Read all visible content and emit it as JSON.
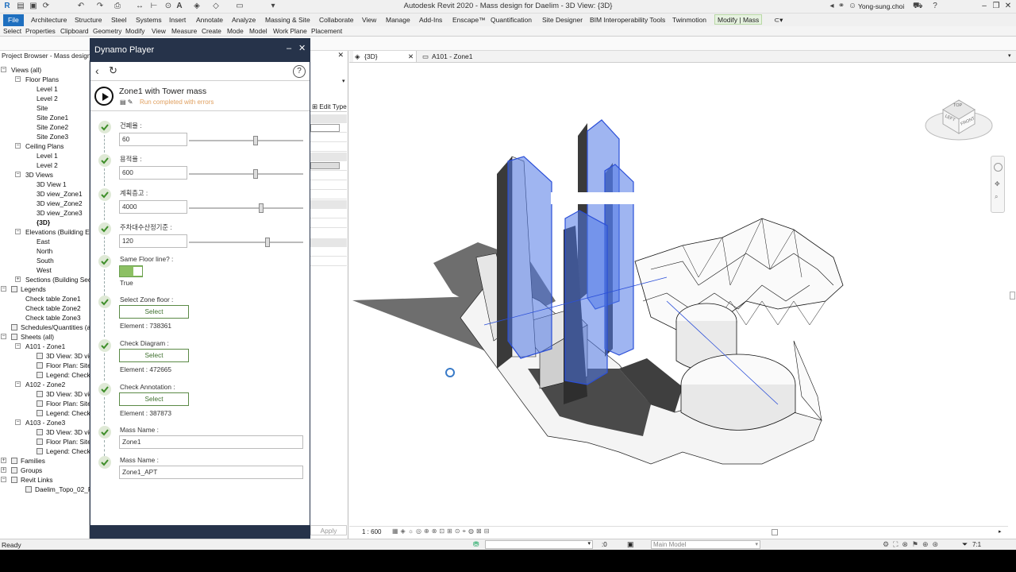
{
  "window": {
    "title": "Autodesk Revit 2020 - Mass design for Daelim - 3D View: {3D}",
    "user": "Yong-sung.choi"
  },
  "ribbon": {
    "tabs": [
      "File",
      "Architecture",
      "Structure",
      "Steel",
      "Systems",
      "Insert",
      "Annotate",
      "Analyze",
      "Massing & Site",
      "Collaborate",
      "View",
      "Manage",
      "Add-Ins",
      "Enscape™",
      "Quantification",
      "Site Designer",
      "BIM Interoperability Tools",
      "Twinmotion",
      "Modify | Mass"
    ],
    "panels": [
      "Select",
      "Properties",
      "Clipboard",
      "Geometry",
      "Modify",
      "View",
      "Measure",
      "Create",
      "Mode",
      "Model",
      "Work Plane",
      "Placement"
    ]
  },
  "project_browser": {
    "title": "Project Browser - Mass design",
    "nodes": [
      {
        "label": "Views (all)",
        "level": 0,
        "exp": "−"
      },
      {
        "label": "Floor Plans",
        "level": 1,
        "exp": "−"
      },
      {
        "label": "Level 1",
        "level": 2
      },
      {
        "label": "Level 2",
        "level": 2
      },
      {
        "label": "Site",
        "level": 2
      },
      {
        "label": "Site Zone1",
        "level": 2
      },
      {
        "label": "Site Zone2",
        "level": 2
      },
      {
        "label": "Site Zone3",
        "level": 2
      },
      {
        "label": "Ceiling Plans",
        "level": 1,
        "exp": "−"
      },
      {
        "label": "Level 1",
        "level": 2
      },
      {
        "label": "Level 2",
        "level": 2
      },
      {
        "label": "3D Views",
        "level": 1,
        "exp": "−"
      },
      {
        "label": "3D View 1",
        "level": 2
      },
      {
        "label": "3D view_Zone1",
        "level": 2
      },
      {
        "label": "3D view_Zone2",
        "level": 2
      },
      {
        "label": "3D view_Zone3",
        "level": 2
      },
      {
        "label": "{3D}",
        "level": 2,
        "bold": true
      },
      {
        "label": "Elevations (Building Ele",
        "level": 1,
        "exp": "−"
      },
      {
        "label": "East",
        "level": 2
      },
      {
        "label": "North",
        "level": 2
      },
      {
        "label": "South",
        "level": 2
      },
      {
        "label": "West",
        "level": 2
      },
      {
        "label": "Sections (Building Sec",
        "level": 1,
        "exp": "+"
      },
      {
        "label": "Legends",
        "level": 0,
        "exp": "−",
        "icon": true
      },
      {
        "label": "Check table Zone1",
        "level": 1
      },
      {
        "label": "Check table Zone2",
        "level": 1
      },
      {
        "label": "Check table Zone3",
        "level": 1
      },
      {
        "label": "Schedules/Quantities (a",
        "level": 0,
        "icon": true
      },
      {
        "label": "Sheets (all)",
        "level": 0,
        "exp": "−",
        "icon": true
      },
      {
        "label": "A101 - Zone1",
        "level": 1,
        "exp": "−"
      },
      {
        "label": "3D View: 3D vie",
        "level": 2,
        "icon": true
      },
      {
        "label": "Floor Plan: Site",
        "level": 2,
        "icon": true
      },
      {
        "label": "Legend: Check t",
        "level": 2,
        "icon": true
      },
      {
        "label": "A102 - Zone2",
        "level": 1,
        "exp": "−"
      },
      {
        "label": "3D View: 3D vie",
        "level": 2,
        "icon": true
      },
      {
        "label": "Floor Plan: Site",
        "level": 2,
        "icon": true
      },
      {
        "label": "Legend: Check t",
        "level": 2,
        "icon": true
      },
      {
        "label": "A103 - Zone3",
        "level": 1,
        "exp": "−"
      },
      {
        "label": "3D View: 3D vie",
        "level": 2,
        "icon": true
      },
      {
        "label": "Floor Plan: Site",
        "level": 2,
        "icon": true
      },
      {
        "label": "Legend: Check t",
        "level": 2,
        "icon": true
      },
      {
        "label": "Families",
        "level": 0,
        "exp": "+",
        "icon": true
      },
      {
        "label": "Groups",
        "level": 0,
        "exp": "+",
        "icon": true
      },
      {
        "label": "Revit Links",
        "level": 0,
        "exp": "−",
        "icon": true
      },
      {
        "label": "Daelim_Topo_02_Fi",
        "level": 1,
        "icon": true
      }
    ]
  },
  "dynamo": {
    "title": "Dynamo Player",
    "script_name": "Zone1 with Tower mass",
    "status": "Run completed with errors",
    "inputs": [
      {
        "label": "건폐율 :",
        "value": "60",
        "fill": 0.58
      },
      {
        "label": "용적율 :",
        "value": "600",
        "fill": 0.58
      },
      {
        "label": "계획층고 :",
        "value": "4000",
        "fill": 0.63
      },
      {
        "label": "주차대수산정기준 :",
        "value": "120",
        "fill": 0.69
      }
    ],
    "toggle": {
      "label": "Same Floor line? :",
      "value": "True"
    },
    "selects": [
      {
        "label": "Select Zone floor :",
        "button": "Select",
        "element": "Element : 738361"
      },
      {
        "label": "Check Diagram :",
        "button": "Select",
        "element": "Element : 472665"
      },
      {
        "label": "Check Annotation :",
        "button": "Select",
        "element": "Element : 387873"
      }
    ],
    "texts": [
      {
        "label": "Mass Name :",
        "value": "Zone1"
      },
      {
        "label": "Mass Name :",
        "value": "Zone1_APT"
      }
    ]
  },
  "properties": {
    "edit_type": "Edit Type",
    "apply": "Apply"
  },
  "views": {
    "tabs": [
      "{3D}",
      "A101 - Zone1"
    ],
    "scale": "1 : 600",
    "viewcube_top": "TOP",
    "viewcube_front": "FRONT",
    "viewcube_left": "LEFT"
  },
  "status": {
    "left": "Ready",
    "count": ":0",
    "model": "Main Model",
    "filter": "7:1"
  }
}
